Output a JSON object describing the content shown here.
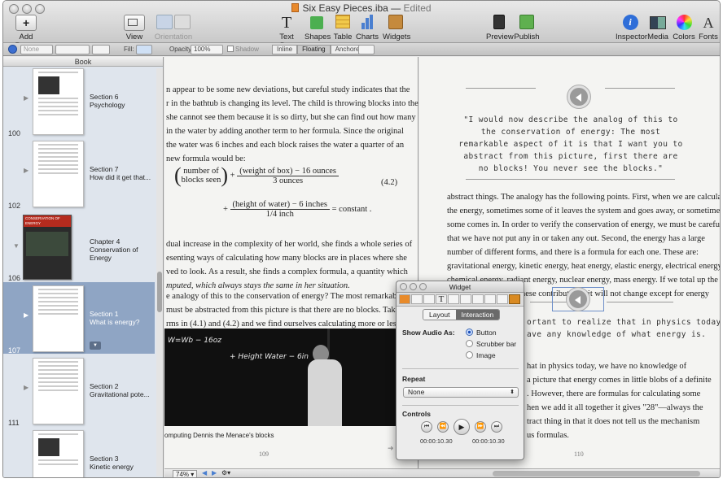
{
  "window": {
    "title": "Six Easy Pieces.iba",
    "status": "Edited"
  },
  "toolbar": {
    "add_pages": "Add Pages",
    "view": "View",
    "orientation": "Orientation",
    "text_box": "Text Box",
    "shapes": "Shapes",
    "table": "Table",
    "charts": "Charts",
    "widgets": "Widgets",
    "preview": "Preview",
    "publish": "Publish",
    "inspector": "Inspector",
    "media": "Media",
    "colors": "Colors",
    "fonts": "Fonts"
  },
  "formatbar": {
    "stroke_value": "None",
    "fill_label": "Fill:",
    "opacity_label": "Opacity:",
    "opacity_value": "100%",
    "shadow_label": "Shadow",
    "inline": "Inline",
    "floating": "Floating",
    "anchored": "Anchored"
  },
  "sidebar": {
    "header": "Book",
    "items": [
      {
        "title": "Section 6",
        "subtitle": "Psychology",
        "page": "100"
      },
      {
        "title": "Section 7",
        "subtitle": "How did it get that...",
        "page": "102"
      },
      {
        "title": "Chapter 4",
        "subtitle": "Conservation of Energy",
        "page": "106"
      },
      {
        "title": "Section 1",
        "subtitle": "What is energy?",
        "page": "107"
      },
      {
        "title": "Section 2",
        "subtitle": "Gravitational pote...",
        "page": "111"
      },
      {
        "title": "Section 3",
        "subtitle": "Kinetic energy",
        "page": ""
      }
    ],
    "chapter_thumb_text": "CONSERVATION OF ENERGY"
  },
  "left_page": {
    "lines": [
      "n appear to be some new deviations, but careful study indicates that the",
      "r in the bathtub is changing its level. The child is throwing blocks into the",
      "she cannot see them because it is so dirty, but she can find out how many",
      "in the water by adding another term to her formula. Since the original",
      "the water was 6 inches and each block raises the water a quarter of an",
      "new formula would be:"
    ],
    "eq1_num": "number of",
    "eq1_den": "blocks seen",
    "eq1_frac_num": "(weight of box) − 16 ounces",
    "eq1_frac_den": "3 ounces",
    "eq1_ref": "(4.2)",
    "eq2_frac_num": "(height of water) − 6 inches",
    "eq2_frac_den": "1/4 inch",
    "eq2_rhs": "= constant .",
    "lines2": [
      "dual increase in the complexity of her world, she finds a whole series of",
      "esenting ways of calculating how many blocks are in places where she",
      "ved to look. As a result, she finds a complex formula, a quantity which",
      "mputed, which always stays the same in her situation."
    ],
    "lines3": [
      "e analogy of this to the conservation of energy? The most remarkable",
      "must be abstracted from this picture is that there are no blocks. Take away",
      "rms in (4.1) and (4.2) and we find ourselves calculating more or less"
    ],
    "chalk1": "W=Wb − 16oz",
    "chalk2": "+ Height Water − 6in",
    "caption": "omputing Dennis the Menace's blocks",
    "page_number": "109"
  },
  "right_page": {
    "quote": "\"I would now describe the analog of this to the conservation of energy: The most remarkable aspect of it is that I want you to abstract from this picture, first there are no blocks! You never see the blocks.\"",
    "lines": [
      "abstract things. The analogy has the following points. First, when we are calculating",
      "the energy, sometimes some of it leaves the system and goes away, or sometimes",
      "some comes in. In order to verify the conservation of energy, we must be careful",
      "that we have not put any in or taken any out. Second, the energy has a large",
      "number of different forms, and there is a formula for each one. These are:",
      "gravitational energy, kinetic energy, heat energy, elastic energy, electrical energy,",
      "chemical energy, radiant energy, nuclear energy, mass energy. If we total up the",
      "formulas for each of these contributions, it will not change except for energy"
    ],
    "quote2_lines": [
      "ortant to realize that in physics today",
      "ave any knowledge of what energy is."
    ],
    "lines2": [
      "hat in physics today, we have no knowledge of",
      "a picture that energy comes in little blobs of a definite",
      ". However, there are formulas for calculating some",
      "hen we add it all together it gives \"28\"—always the",
      "tract thing in that it does not tell us the mechanism",
      "us formulas."
    ],
    "page_number": "110"
  },
  "statusbar": {
    "zoom": "74%"
  },
  "inspector": {
    "title": "Widget",
    "tab_layout": "Layout",
    "tab_interaction": "Interaction",
    "show_audio_label": "Show Audio As:",
    "opt_button": "Button",
    "opt_scrubber": "Scrubber bar",
    "opt_image": "Image",
    "repeat_label": "Repeat",
    "repeat_value": "None",
    "controls_label": "Controls",
    "time_start": "00:00:10.30",
    "time_end": "00:00:10.30"
  }
}
